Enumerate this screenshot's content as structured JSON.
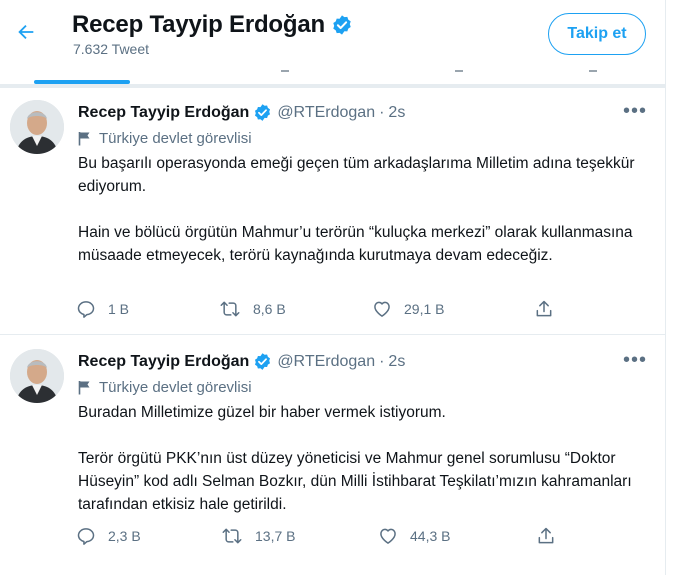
{
  "header": {
    "display_name": "Recep Tayyip Erdoğan",
    "tweet_count": "7.632 Tweet",
    "follow_label": "Takip et"
  },
  "tweets": [
    {
      "name": "Recep Tayyip Erdoğan",
      "handle": "@RTErdogan",
      "dot": "·",
      "time": "2s",
      "label": "Türkiye devlet görevlisi",
      "paragraphs": [
        "Bu başarılı operasyonda emeği geçen tüm arkadaşlarıma Milletim adına teşekkür ediyorum.",
        "Hain ve bölücü örgütün Mahmur’u terörün “kuluçka merkezi” olarak kullanmasına müsaade etmeyecek, terörü kaynağında kurutmaya devam edeceğiz."
      ],
      "replies": "1 B",
      "retweets": "8,6 B",
      "likes": "29,1 B"
    },
    {
      "name": "Recep Tayyip Erdoğan",
      "handle": "@RTErdogan",
      "dot": "·",
      "time": "2s",
      "label": "Türkiye devlet görevlisi",
      "paragraphs": [
        "Buradan Milletimize güzel bir haber vermek istiyorum.",
        "Terör örgütü PKK’nın üst düzey yöneticisi ve Mahmur genel sorumlusu “Doktor Hüseyin” kod adlı Selman Bozkır, dün Milli İstihbarat Teşkilatı’mızın kahramanları tarafından etkisiz hale getirildi."
      ],
      "replies": "2,3 B",
      "retweets": "13,7 B",
      "likes": "44,3 B"
    }
  ],
  "colors": {
    "accent": "#1da1f2",
    "secondary_text": "#5b7083",
    "verified": "#1da1f2",
    "divider": "#e6ecf0"
  },
  "icons": [
    "back-arrow-icon",
    "verified-badge-icon",
    "flag-icon",
    "more-icon",
    "reply-icon",
    "retweet-icon",
    "like-icon",
    "share-icon"
  ]
}
